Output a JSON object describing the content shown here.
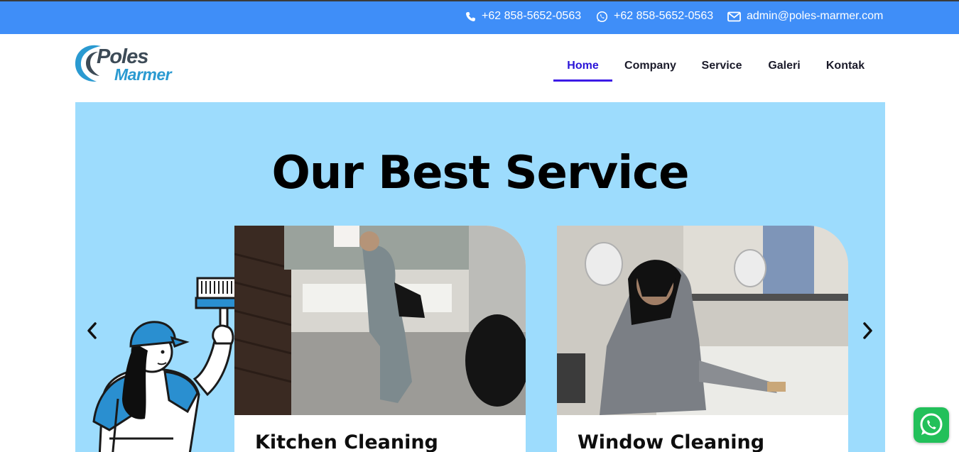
{
  "topbar": {
    "phone": {
      "icon": "phone-icon",
      "text": "+62 858-5652-0563"
    },
    "whatsapp": {
      "icon": "whatsapp-icon",
      "text": "+62 858-5652-0563"
    },
    "email": {
      "icon": "envelope-icon",
      "text": "admin@poles-marmer.com"
    }
  },
  "logo": {
    "word1": "Poles",
    "word2": "Marmer"
  },
  "nav": {
    "items": [
      {
        "label": "Home",
        "active": true
      },
      {
        "label": "Company",
        "active": false
      },
      {
        "label": "Service",
        "active": false
      },
      {
        "label": "Galeri",
        "active": false
      },
      {
        "label": "Kontak",
        "active": false
      }
    ]
  },
  "hero": {
    "title": "Our Best Service",
    "cards": [
      {
        "caption": "Kitchen Cleaning"
      },
      {
        "caption": "Window Cleaning"
      }
    ],
    "prev_icon": "chevron-left-icon",
    "next_icon": "chevron-right-icon"
  },
  "floating": {
    "icon": "whatsapp-icon"
  },
  "colors": {
    "topbar": "#3f8ef8",
    "hero_bg": "#9ddcfd",
    "nav_active": "#2a14d8",
    "logo_dark": "#3d4b57",
    "logo_blue": "#2a9ad1",
    "whatsapp_green": "#22c05a"
  }
}
